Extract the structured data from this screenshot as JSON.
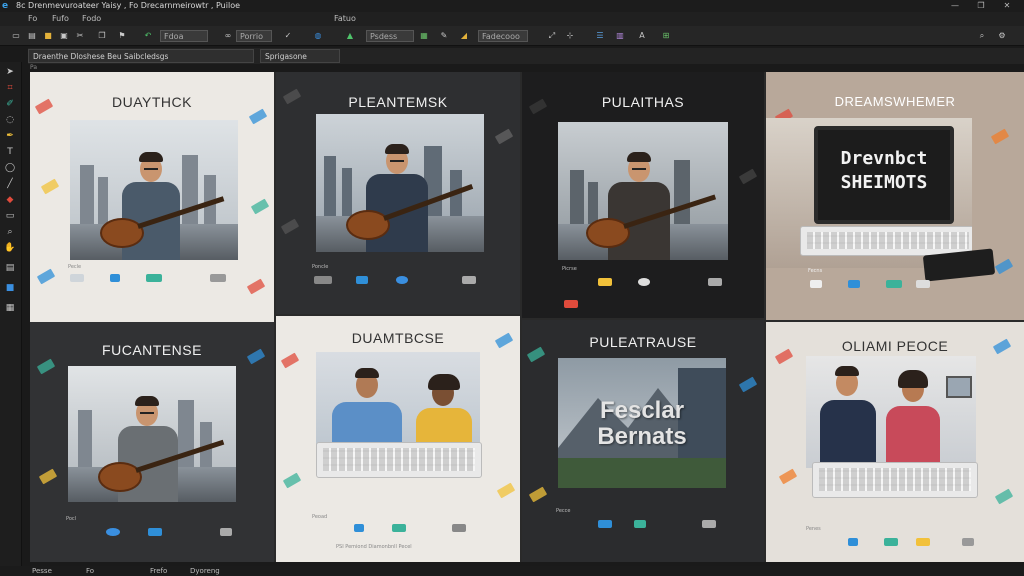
{
  "titlebar": {
    "logo_glyph": "e",
    "title": "8c  Drenmevuroateer Yaisy , Fo Drecarnmeirowtr , Puiloe",
    "minimize": "—",
    "maximize": "❐",
    "close": "✕"
  },
  "menubar": {
    "items": [
      "Fo",
      "Fufo",
      "Fodo",
      "Fatuo"
    ]
  },
  "toolbar": {
    "zoom_select": "Fdoa",
    "mode_select": "Porrio",
    "field_select": "Psdess",
    "view_select": "Fadecooo",
    "search_icon": "⌕",
    "settings_icon": "⚙"
  },
  "tabs": [
    {
      "label": "Draenthe Dloshese Beu Saibcledsgs"
    },
    {
      "label": "Sprigasone"
    }
  ],
  "doc_label": "Pa",
  "cards": [
    {
      "title": "DUAYTHCK",
      "caption": "Pecle"
    },
    {
      "title": "PLEANTEMSK",
      "caption": "Poncle"
    },
    {
      "title": "PULAITHAS",
      "caption": "Picrse"
    },
    {
      "title": "DREAMSWHEMER",
      "screen_line1": "Drevnbct",
      "screen_line2": "SHEIMOTS",
      "caption": "Fecns"
    },
    {
      "title": "FUCANTENSE",
      "caption": "Pocl"
    },
    {
      "title": "DUAMTBCSE",
      "caption": "Peoad",
      "footer": "PSI Pemiond Diamonbnll Pecel"
    },
    {
      "title": "PULEATRAUSE",
      "photo_line1": "Fesclar",
      "photo_line2": "Bernats",
      "caption": "Pecce"
    },
    {
      "title": "OLIAMI PEOCE",
      "caption": "Penes"
    }
  ],
  "statusbar": {
    "left": "Pesse",
    "items": [
      "Fo",
      "Frefo",
      "Dyoreng"
    ]
  },
  "colors": {
    "confetti": [
      "#e04b3c",
      "#2f8fd8",
      "#f2c13a",
      "#3bb29a",
      "#8a5cc7",
      "#f07d2a"
    ]
  }
}
